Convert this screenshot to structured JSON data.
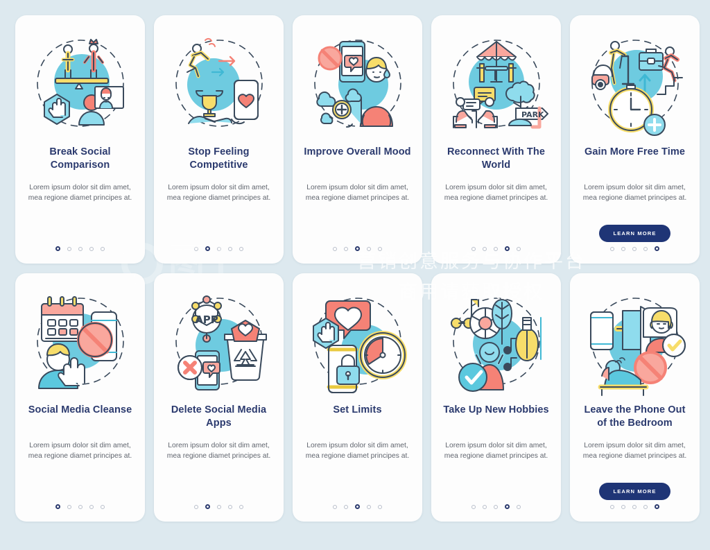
{
  "page": {
    "background_color": "#dde9ef",
    "card_background": "#fdfdfd",
    "title_color": "#2b3a6e",
    "body_color": "#60656e",
    "accent_button_color": "#1f3576",
    "accent_teal": "#5bc8de",
    "accent_coral": "#f58276",
    "accent_yellow": "#f7dd6a"
  },
  "watermark": {
    "logo_text": "图",
    "tagline_line1": "营销创意服务与协作平台",
    "tagline_line2": "商用请获取授权"
  },
  "shared": {
    "body_text": "Lorem ipsum dolor sit dim amet, mea regione diamet principes at.",
    "learn_more_label": "LEARN MORE",
    "dot_count": 5
  },
  "cards": [
    {
      "id": "break-social-comparison",
      "title": "Break Social Comparison",
      "body": "Lorem ipsum dolor sit dim amet, mea regione diamet principes at.",
      "active_dot": 1,
      "has_button": false,
      "illustration": "balance-scale-people-stop-hand-video-call"
    },
    {
      "id": "stop-feeling-competitive",
      "title": "Stop Feeling Competitive",
      "body": "Lorem ipsum dolor sit dim amet, mea regione diamet principes at.",
      "active_dot": 2,
      "has_button": false,
      "illustration": "runner-trophy-handshake-phone-heart"
    },
    {
      "id": "improve-overall-mood",
      "title": "Improve Overall Mood",
      "body": "Lorem ipsum dolor sit dim amet, mea regione diamet principes at.",
      "active_dot": 3,
      "has_button": false,
      "illustration": "phone-like-blocked-sad-person-clouds"
    },
    {
      "id": "reconnect-with-the-world",
      "title": "Reconnect With The World",
      "body": "Lorem ipsum dolor sit dim amet, mea regione diamet principes at.",
      "active_dot": 4,
      "has_button": false,
      "illustration": "cafe-table-umbrella-people-talking-park-sign"
    },
    {
      "id": "gain-more-free-time",
      "title": "Gain More Free Time",
      "body": "Lorem ipsum dolor sit dim amet, mea regione diamet principes at.",
      "active_dot": 5,
      "has_button": true,
      "button_label": "LEARN MORE",
      "illustration": "clock-plus-briefcase-stairs-vacuum"
    },
    {
      "id": "social-media-cleanse",
      "title": "Social Media Cleanse",
      "body": "Lorem ipsum dolor sit dim amet, mea regione diamet principes at.",
      "active_dot": 1,
      "has_button": false,
      "illustration": "calendar-phone-prohibited-person-hand"
    },
    {
      "id": "delete-social-media-apps",
      "title": "Delete Social Media Apps",
      "body": "Lorem ipsum dolor sit dim amet, mea regione diamet principes at.",
      "active_dot": 2,
      "has_button": false,
      "illustration": "app-network-trash-recycle-phone-x"
    },
    {
      "id": "set-limits",
      "title": "Set Limits",
      "body": "Lorem ipsum dolor sit dim amet, mea regione diamet principes at.",
      "active_dot": 3,
      "has_button": false,
      "illustration": "heart-bubble-stop-hand-phone-lock-clock"
    },
    {
      "id": "take-up-new-hobbies",
      "title": "Take Up New Hobbies",
      "body": "Lorem ipsum dolor sit dim amet, mea regione diamet principes at.",
      "active_dot": 4,
      "has_button": false,
      "illustration": "skate-ball-plant-violin-person-check"
    },
    {
      "id": "leave-the-phone-out-of-the-bedroom",
      "title": "Leave the Phone Out of the Bedroom",
      "body": "Lorem ipsum dolor sit dim amet, mea regione diamet principes at.",
      "active_dot": 5,
      "has_button": true,
      "button_label": "LEARN MORE",
      "illustration": "phone-door-bed-sleeping-person-prohibited"
    }
  ]
}
